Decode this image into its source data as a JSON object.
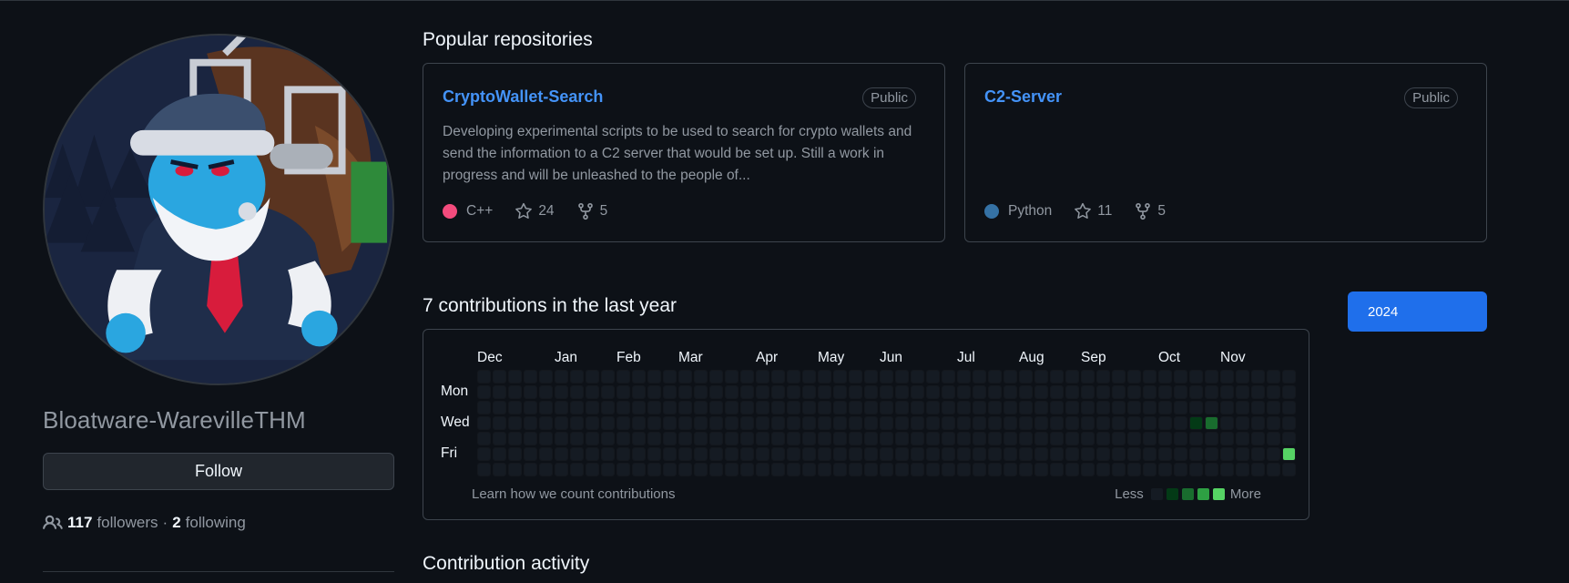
{
  "profile": {
    "username": "Bloatware-WarevilleTHM",
    "follow_label": "Follow",
    "followers_count": "117",
    "followers_label": "followers",
    "separator": "·",
    "following_count": "2",
    "following_label": "following"
  },
  "popular": {
    "title": "Popular repositories",
    "repos": [
      {
        "name": "CryptoWallet-Search",
        "visibility": "Public",
        "description": "Developing experimental scripts to be used to search for crypto wallets and send the information to a C2 server that would be set up. Still a work in progress and will be unleashed to the people of...",
        "language": "C++",
        "language_color": "#f34b7d",
        "stars": "24",
        "forks": "5"
      },
      {
        "name": "C2-Server",
        "visibility": "Public",
        "description": "",
        "language": "Python",
        "language_color": "#3572A5",
        "stars": "11",
        "forks": "5"
      }
    ]
  },
  "contributions": {
    "title": "7 contributions in the last year",
    "year": "2024",
    "months": [
      "Dec",
      "Jan",
      "Feb",
      "Mar",
      "Apr",
      "May",
      "Jun",
      "Jul",
      "Aug",
      "Sep",
      "Oct",
      "Nov"
    ],
    "days": [
      "Mon",
      "Wed",
      "Fri"
    ],
    "learn_link": "Learn how we count contributions",
    "legend_less": "Less",
    "legend_more": "More",
    "level_colors": [
      "#151b23",
      "#033a16",
      "#196c2e",
      "#2ea043",
      "#56d364"
    ],
    "active_cells": [
      {
        "week": 46,
        "day": 3,
        "level": 1
      },
      {
        "week": 47,
        "day": 3,
        "level": 2
      },
      {
        "week": 52,
        "day": 5,
        "level": 4
      }
    ]
  },
  "activity": {
    "title": "Contribution activity"
  }
}
